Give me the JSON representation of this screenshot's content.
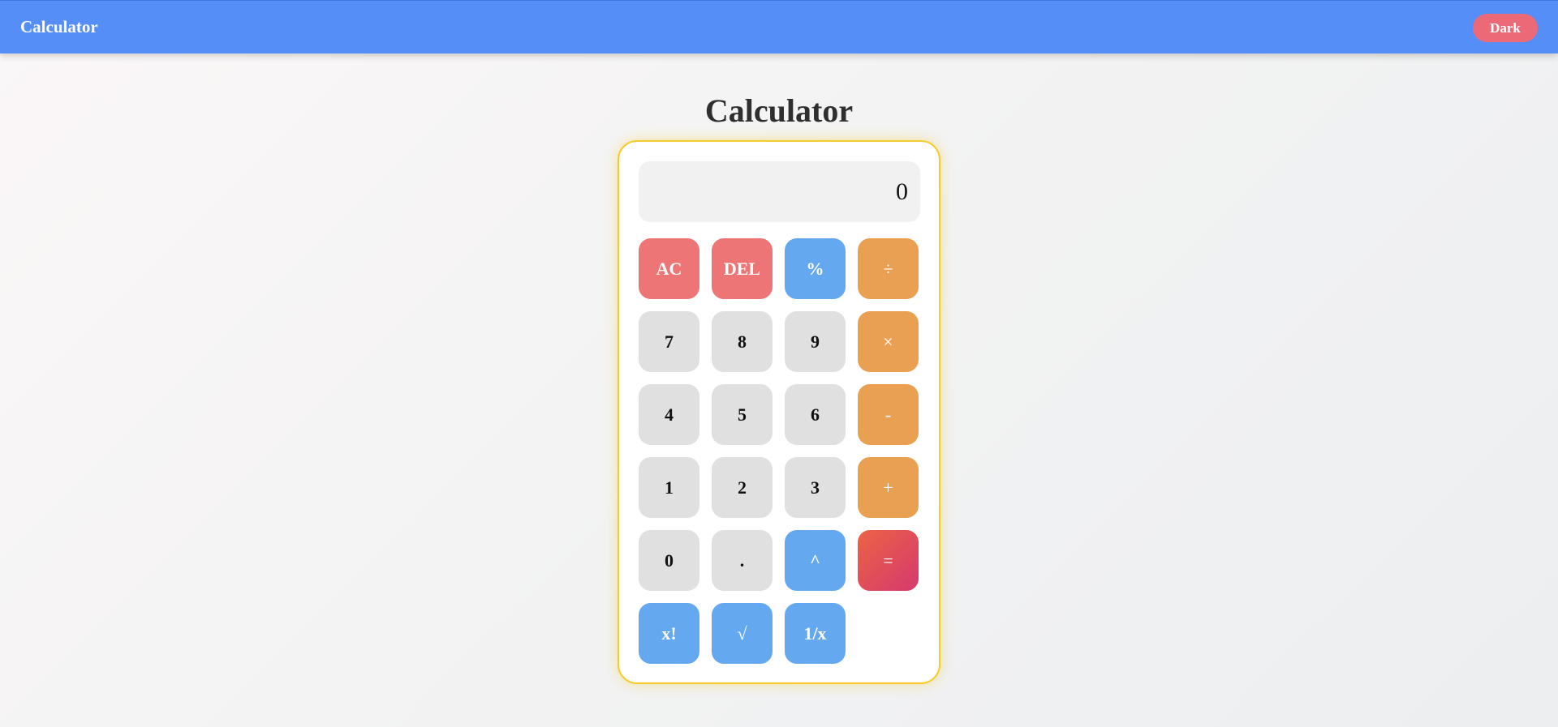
{
  "header": {
    "brand": "Calculator",
    "theme_toggle_label": "Dark"
  },
  "main": {
    "title": "Calculator"
  },
  "calculator": {
    "display_value": "0",
    "keys": [
      {
        "label": "AC",
        "kind": "danger",
        "name": "clear-all-button"
      },
      {
        "label": "DEL",
        "kind": "danger",
        "name": "delete-button"
      },
      {
        "label": "%",
        "kind": "func",
        "name": "percent-button"
      },
      {
        "label": "÷",
        "kind": "op",
        "name": "divide-button"
      },
      {
        "label": "7",
        "kind": "num",
        "name": "digit-7-button"
      },
      {
        "label": "8",
        "kind": "num",
        "name": "digit-8-button"
      },
      {
        "label": "9",
        "kind": "num",
        "name": "digit-9-button"
      },
      {
        "label": "×",
        "kind": "op",
        "name": "multiply-button"
      },
      {
        "label": "4",
        "kind": "num",
        "name": "digit-4-button"
      },
      {
        "label": "5",
        "kind": "num",
        "name": "digit-5-button"
      },
      {
        "label": "6",
        "kind": "num",
        "name": "digit-6-button"
      },
      {
        "label": "-",
        "kind": "op",
        "name": "subtract-button"
      },
      {
        "label": "1",
        "kind": "num",
        "name": "digit-1-button"
      },
      {
        "label": "2",
        "kind": "num",
        "name": "digit-2-button"
      },
      {
        "label": "3",
        "kind": "num",
        "name": "digit-3-button"
      },
      {
        "label": "+",
        "kind": "op",
        "name": "add-button"
      },
      {
        "label": "0",
        "kind": "num",
        "name": "digit-0-button"
      },
      {
        "label": ".",
        "kind": "num",
        "name": "decimal-point-button"
      },
      {
        "label": "^",
        "kind": "func",
        "name": "power-button"
      },
      {
        "label": "=",
        "kind": "eq",
        "name": "equals-button"
      },
      {
        "label": "x!",
        "kind": "func",
        "name": "factorial-button"
      },
      {
        "label": "√",
        "kind": "func",
        "name": "square-root-button"
      },
      {
        "label": "1/x",
        "kind": "func",
        "name": "reciprocal-button"
      }
    ]
  },
  "colors": {
    "header": "#548ef6",
    "theme_toggle": "#ec6a78",
    "danger_key": "#ee7575",
    "function_key": "#64a8f0",
    "operator_key": "#e9a052",
    "number_key": "#e0e0e0",
    "equals_key_start": "#ec6344",
    "equals_key_end": "#d6396e",
    "calculator_border": "#f5cc2c"
  }
}
